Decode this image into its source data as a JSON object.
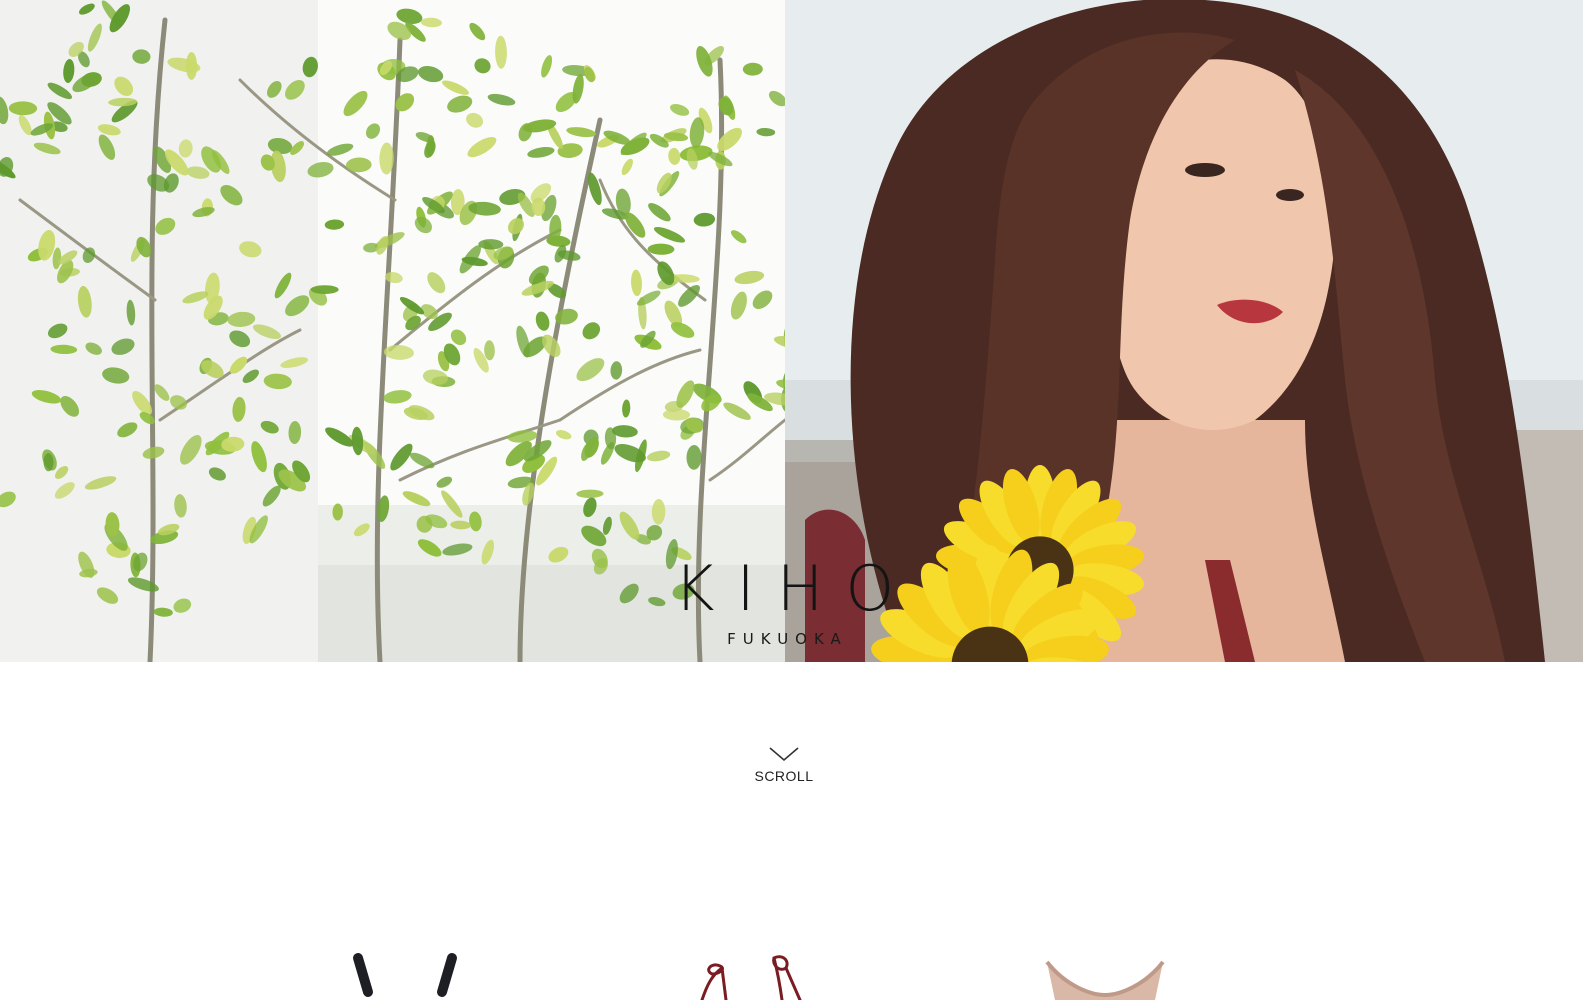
{
  "brand": {
    "name": "KIHO",
    "location": "FUKUOKA"
  },
  "scroll": {
    "label": "SCROLL",
    "icon": "chevron-down-icon"
  },
  "hero": {
    "left_photo": "tree-foliage-photo",
    "right_photo": "model-with-sunflower-photo"
  },
  "products": [
    {
      "icon": "black-strap-garment"
    },
    {
      "icon": "burgundy-tie-garment"
    },
    {
      "icon": "nude-top-garment"
    }
  ],
  "colors": {
    "text": "#141414",
    "background": "#ffffff",
    "foliage": "#7fb23a",
    "sunflower": "#f5cf1c"
  }
}
